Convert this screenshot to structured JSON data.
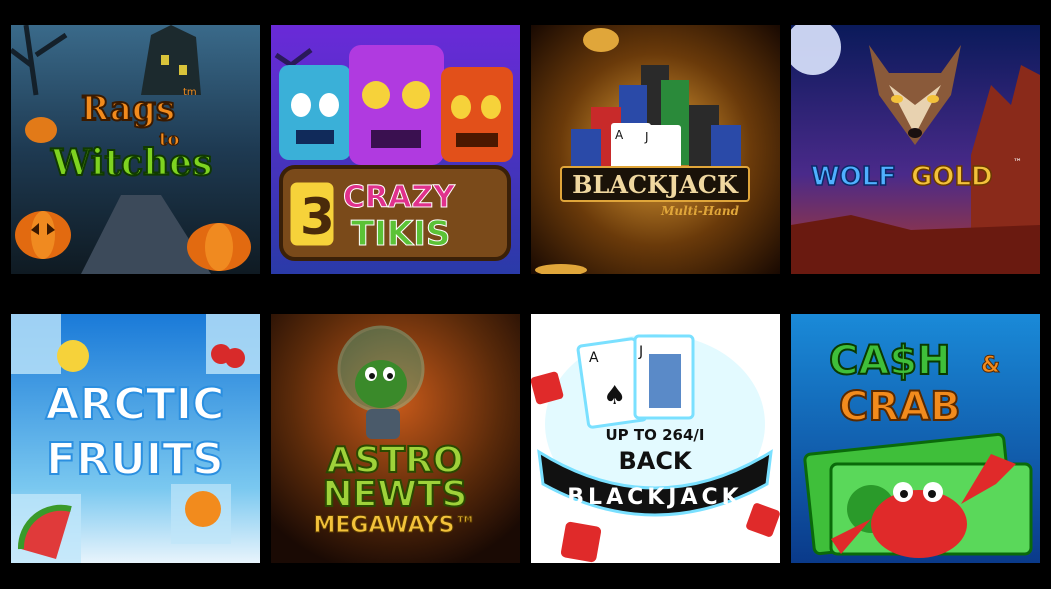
{
  "games": [
    {
      "title_line1": "Rags",
      "title_tm": "tm",
      "title_line2": "to",
      "title_line3": "Witches"
    },
    {
      "number": "3",
      "title_line1": "CRAZY",
      "title_line2": "TIKIS"
    },
    {
      "title": "BLACKJACK",
      "subtitle": "Multi-Hand"
    },
    {
      "title_line1": "WOLF",
      "title_line2": "GOLD",
      "title_tm": "™"
    },
    {
      "title_line1": "ARCTIC",
      "title_line2": "FRUITS"
    },
    {
      "title_line1": "ASTRO",
      "title_line2": "NEWTS",
      "title_line3": "MEGAWAYS™"
    },
    {
      "promo_line1": "UP TO 264/I",
      "promo_line2": "BACK",
      "title": "BLACKJACK",
      "card_rank_a": "A",
      "card_rank_j": "J"
    },
    {
      "title_line1": "CA$H",
      "title_amp": "&",
      "title_line2": "CRAB"
    }
  ],
  "colors": {
    "background": "#000000",
    "witches_green": "#7ed321",
    "witches_orange": "#f28b1d",
    "tiki_yellow": "#f6d23a",
    "tiki_pink": "#e0318c",
    "tiki_green": "#5bc236",
    "blackjack_gold": "#e0a63a",
    "wolf_blue": "#4fb0ff",
    "wolf_gold": "#f3c23b",
    "arctic_blue": "#2b8fe0",
    "astro_green": "#9fd23a",
    "back_black": "#111111",
    "cash_green": "#3fbf3a",
    "cash_orange": "#f28b1d"
  }
}
